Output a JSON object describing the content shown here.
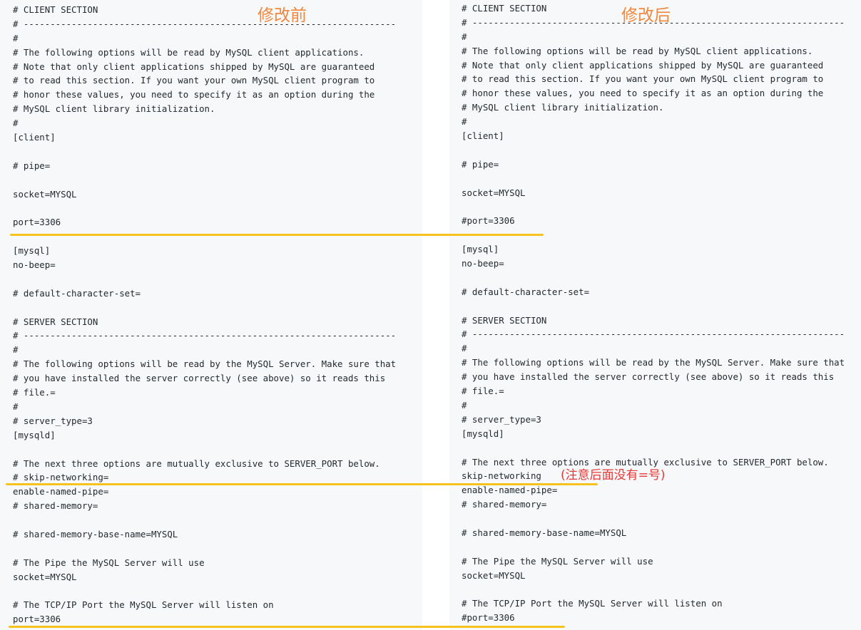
{
  "labels": {
    "before": "修改前",
    "after": "修改后",
    "note": "(注意后面没有=号)"
  },
  "before_lines": [
    "# CLIENT SECTION",
    "# ----------------------------------------------------------------------",
    "#",
    "# The following options will be read by MySQL client applications.",
    "# Note that only client applications shipped by MySQL are guaranteed",
    "# to read this section. If you want your own MySQL client program to",
    "# honor these values, you need to specify it as an option during the",
    "# MySQL client library initialization.",
    "#",
    "[client]",
    "",
    "# pipe=",
    "",
    "socket=MYSQL",
    "",
    "port=3306",
    "",
    "[mysql]",
    "no-beep=",
    "",
    "# default-character-set=",
    "",
    "# SERVER SECTION",
    "# ----------------------------------------------------------------------",
    "#",
    "# The following options will be read by the MySQL Server. Make sure that",
    "# you have installed the server correctly (see above) so it reads this",
    "# file.=",
    "#",
    "# server_type=3",
    "[mysqld]",
    "",
    "# The next three options are mutually exclusive to SERVER_PORT below.",
    "# skip-networking=",
    "enable-named-pipe=",
    "# shared-memory=",
    "",
    "# shared-memory-base-name=MYSQL",
    "",
    "# The Pipe the MySQL Server will use",
    "socket=MYSQL",
    "",
    "# The TCP/IP Port the MySQL Server will listen on",
    "port=3306"
  ],
  "after_lines": [
    "# CLIENT SECTION",
    "# ----------------------------------------------------------------------",
    "#",
    "# The following options will be read by MySQL client applications.",
    "# Note that only client applications shipped by MySQL are guaranteed",
    "# to read this section. If you want your own MySQL client program to",
    "# honor these values, you need to specify it as an option during the",
    "# MySQL client library initialization.",
    "#",
    "[client]",
    "",
    "# pipe=",
    "",
    "socket=MYSQL",
    "",
    "#port=3306",
    "",
    "[mysql]",
    "no-beep=",
    "",
    "# default-character-set=",
    "",
    "# SERVER SECTION",
    "# ----------------------------------------------------------------------",
    "#",
    "# The following options will be read by the MySQL Server. Make sure that",
    "# you have installed the server correctly (see above) so it reads this",
    "# file.=",
    "#",
    "# server_type=3",
    "[mysqld]",
    "",
    "# The next three options are mutually exclusive to SERVER_PORT below.",
    "skip-networking",
    "enable-named-pipe=",
    "# shared-memory=",
    "",
    "# shared-memory-base-name=MYSQL",
    "",
    "# The Pipe the MySQL Server will use",
    "socket=MYSQL",
    "",
    "# The TCP/IP Port the MySQL Server will listen on",
    "#port=3306"
  ],
  "colors": {
    "highlight": "#f7c21b",
    "label": "#f0883e",
    "note": "#e53935"
  }
}
